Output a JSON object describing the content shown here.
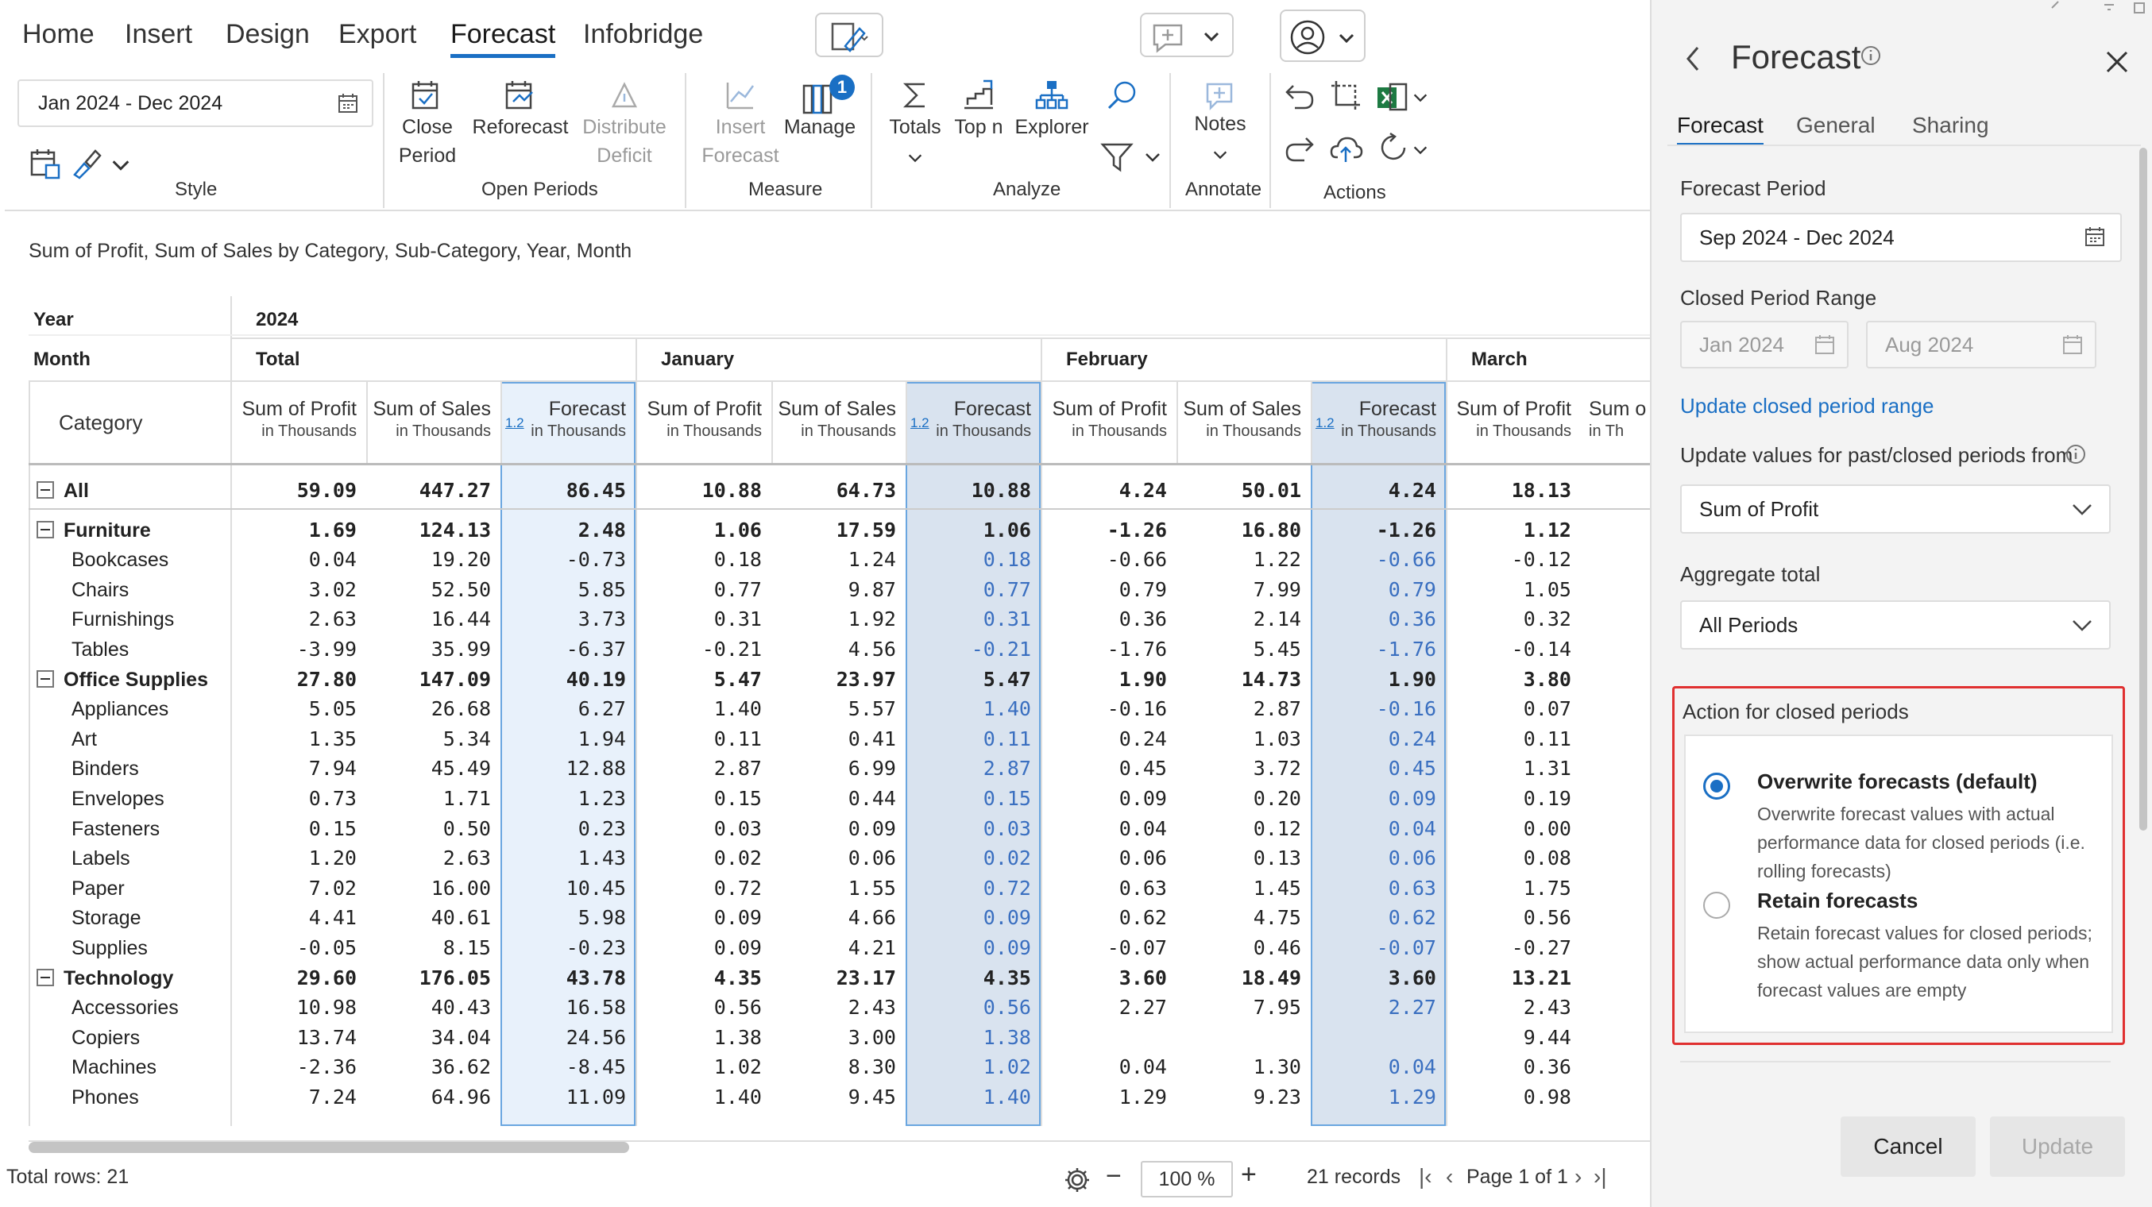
{
  "menu": {
    "items": [
      "Home",
      "Insert",
      "Design",
      "Export",
      "Forecast",
      "Infobridge"
    ],
    "active": "Forecast"
  },
  "ribbon": {
    "date_range": "Jan 2024 - Dec 2024",
    "groups": {
      "style": "Style",
      "open_periods": "Open Periods",
      "measure": "Measure",
      "analyze": "Analyze",
      "annotate": "Annotate",
      "actions": "Actions"
    },
    "buttons": {
      "close_period": [
        "Close",
        "Period"
      ],
      "reforecast": "Reforecast",
      "distribute_deficit": [
        "Distribute",
        "Deficit"
      ],
      "insert_forecast": [
        "Insert",
        "Forecast"
      ],
      "manage": "Manage",
      "manage_badge": "1",
      "totals": "Totals",
      "top_n": "Top n",
      "explorer": "Explorer",
      "notes": "Notes"
    }
  },
  "caption": "Sum of Profit, Sum of Sales by Category, Sub-Category, Year, Month",
  "grid": {
    "row_headers": {
      "year": "Year",
      "month": "Month",
      "category": "Category"
    },
    "year": "2024",
    "months": [
      "Total",
      "January",
      "February",
      "March"
    ],
    "measure_headers": [
      {
        "label": "Sum of Profit",
        "sub": "in Thousands"
      },
      {
        "label": "Sum of Sales",
        "sub": "in Thousands"
      },
      {
        "label": "Forecast",
        "sub": "in Thousands",
        "badge": "1.2"
      }
    ],
    "partial_header": {
      "label": "Sum o",
      "sub": "in Th"
    },
    "rows": [
      {
        "name": "All",
        "level": 0,
        "vals": [
          "59.09",
          "447.27",
          "86.45",
          "10.88",
          "64.73",
          "10.88",
          "4.24",
          "50.01",
          "4.24",
          "18.13"
        ]
      },
      {
        "name": "Furniture",
        "level": 1,
        "vals": [
          "1.69",
          "124.13",
          "2.48",
          "1.06",
          "17.59",
          "1.06",
          "-1.26",
          "16.80",
          "-1.26",
          "1.12"
        ]
      },
      {
        "name": "Bookcases",
        "level": 2,
        "vals": [
          "0.04",
          "19.20",
          "-0.73",
          "0.18",
          "1.24",
          "0.18",
          "-0.66",
          "1.22",
          "-0.66",
          "-0.12"
        ]
      },
      {
        "name": "Chairs",
        "level": 2,
        "vals": [
          "3.02",
          "52.50",
          "5.85",
          "0.77",
          "9.87",
          "0.77",
          "0.79",
          "7.99",
          "0.79",
          "1.05"
        ]
      },
      {
        "name": "Furnishings",
        "level": 2,
        "vals": [
          "2.63",
          "16.44",
          "3.73",
          "0.31",
          "1.92",
          "0.31",
          "0.36",
          "2.14",
          "0.36",
          "0.32"
        ]
      },
      {
        "name": "Tables",
        "level": 2,
        "vals": [
          "-3.99",
          "35.99",
          "-6.37",
          "-0.21",
          "4.56",
          "-0.21",
          "-1.76",
          "5.45",
          "-1.76",
          "-0.14"
        ]
      },
      {
        "name": "Office Supplies",
        "level": 1,
        "vals": [
          "27.80",
          "147.09",
          "40.19",
          "5.47",
          "23.97",
          "5.47",
          "1.90",
          "14.73",
          "1.90",
          "3.80"
        ]
      },
      {
        "name": "Appliances",
        "level": 2,
        "vals": [
          "5.05",
          "26.68",
          "6.27",
          "1.40",
          "5.57",
          "1.40",
          "-0.16",
          "2.87",
          "-0.16",
          "0.07"
        ]
      },
      {
        "name": "Art",
        "level": 2,
        "vals": [
          "1.35",
          "5.34",
          "1.94",
          "0.11",
          "0.41",
          "0.11",
          "0.24",
          "1.03",
          "0.24",
          "0.11"
        ]
      },
      {
        "name": "Binders",
        "level": 2,
        "vals": [
          "7.94",
          "45.49",
          "12.88",
          "2.87",
          "6.99",
          "2.87",
          "0.45",
          "3.72",
          "0.45",
          "1.31"
        ]
      },
      {
        "name": "Envelopes",
        "level": 2,
        "vals": [
          "0.73",
          "1.71",
          "1.23",
          "0.15",
          "0.44",
          "0.15",
          "0.09",
          "0.20",
          "0.09",
          "0.19"
        ]
      },
      {
        "name": "Fasteners",
        "level": 2,
        "vals": [
          "0.15",
          "0.50",
          "0.23",
          "0.03",
          "0.09",
          "0.03",
          "0.04",
          "0.12",
          "0.04",
          "0.00"
        ]
      },
      {
        "name": "Labels",
        "level": 2,
        "vals": [
          "1.20",
          "2.63",
          "1.43",
          "0.02",
          "0.06",
          "0.02",
          "0.06",
          "0.13",
          "0.06",
          "0.08"
        ]
      },
      {
        "name": "Paper",
        "level": 2,
        "vals": [
          "7.02",
          "16.00",
          "10.45",
          "0.72",
          "1.55",
          "0.72",
          "0.63",
          "1.45",
          "0.63",
          "1.75"
        ]
      },
      {
        "name": "Storage",
        "level": 2,
        "vals": [
          "4.41",
          "40.61",
          "5.98",
          "0.09",
          "4.66",
          "0.09",
          "0.62",
          "4.75",
          "0.62",
          "0.56"
        ]
      },
      {
        "name": "Supplies",
        "level": 2,
        "vals": [
          "-0.05",
          "8.15",
          "-0.23",
          "0.09",
          "4.21",
          "0.09",
          "-0.07",
          "0.46",
          "-0.07",
          "-0.27"
        ]
      },
      {
        "name": "Technology",
        "level": 1,
        "vals": [
          "29.60",
          "176.05",
          "43.78",
          "4.35",
          "23.17",
          "4.35",
          "3.60",
          "18.49",
          "3.60",
          "13.21"
        ]
      },
      {
        "name": "Accessories",
        "level": 2,
        "vals": [
          "10.98",
          "40.43",
          "16.58",
          "0.56",
          "2.43",
          "0.56",
          "2.27",
          "7.95",
          "2.27",
          "2.43"
        ]
      },
      {
        "name": "Copiers",
        "level": 2,
        "vals": [
          "13.74",
          "34.04",
          "24.56",
          "1.38",
          "3.00",
          "1.38",
          "",
          "",
          "",
          "9.44"
        ]
      },
      {
        "name": "Machines",
        "level": 2,
        "vals": [
          "-2.36",
          "36.62",
          "-8.45",
          "1.02",
          "8.30",
          "1.02",
          "0.04",
          "1.30",
          "0.04",
          "0.36"
        ]
      },
      {
        "name": "Phones",
        "level": 2,
        "vals": [
          "7.24",
          "64.96",
          "11.09",
          "1.40",
          "9.45",
          "1.40",
          "1.29",
          "9.23",
          "1.29",
          "0.98"
        ]
      }
    ]
  },
  "status": {
    "total_rows": "Total rows: 21",
    "zoom": "100 %",
    "records": "21 records",
    "page": "Page 1 of 1"
  },
  "panel": {
    "title": "Forecast",
    "tabs": [
      "Forecast",
      "General",
      "Sharing"
    ],
    "forecast_period_label": "Forecast Period",
    "forecast_period": "Sep 2024 - Dec 2024",
    "closed_range_label": "Closed Period Range",
    "closed_from": "Jan 2024",
    "closed_to": "Aug 2024",
    "update_link": "Update closed period range",
    "update_values_label": "Update values for past/closed periods from",
    "update_values": "Sum of Profit",
    "aggregate_label": "Aggregate total",
    "aggregate": "All Periods",
    "action_label": "Action for closed periods",
    "options": [
      {
        "title": "Overwrite forecasts (default)",
        "desc": [
          "Overwrite forecast values with actual",
          "performance data for closed periods (i.e.",
          "rolling forecasts)"
        ],
        "selected": true
      },
      {
        "title": "Retain forecasts",
        "desc": [
          "Retain forecast values for closed periods;",
          "show actual performance data only when",
          "forecast values are empty"
        ],
        "selected": false
      }
    ],
    "cancel": "Cancel",
    "update": "Update"
  },
  "colors": {
    "accent": "#1a6fc4",
    "forecast_col": "#e8f1fb",
    "forecast_month": "#d9e3ef",
    "forecast_text": "#3a6fc0",
    "highlight_border": "#e03030"
  }
}
